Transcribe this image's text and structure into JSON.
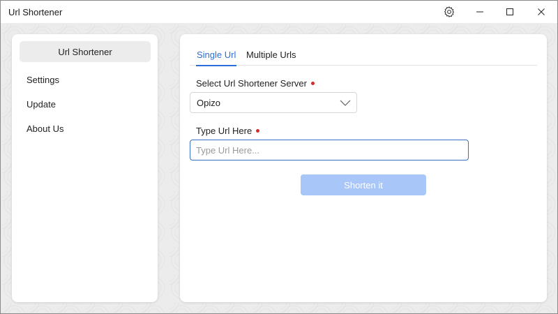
{
  "window": {
    "title": "Url Shortener"
  },
  "sidebar": {
    "items": [
      {
        "label": "Url Shortener",
        "active": true
      },
      {
        "label": "Settings"
      },
      {
        "label": "Update"
      },
      {
        "label": "About Us"
      }
    ]
  },
  "main": {
    "tabs": [
      {
        "label": "Single Url",
        "active": true
      },
      {
        "label": "Multiple Urls"
      }
    ],
    "server_field": {
      "label": "Select Url Shortener Server",
      "value": "Opizo"
    },
    "url_field": {
      "label": "Type Url Here",
      "placeholder": "Type Url Here...",
      "value": ""
    },
    "shorten_button": {
      "label": "Shorten it"
    }
  },
  "icons": {
    "settings": "gear-icon",
    "minimize": "minimize-icon",
    "maximize": "maximize-icon",
    "close": "close-icon",
    "dropdown": "chevron-down-icon"
  },
  "colors": {
    "accent": "#2c6ed5",
    "required": "#d42b2b",
    "button_disabled": "#a8c6f8"
  }
}
